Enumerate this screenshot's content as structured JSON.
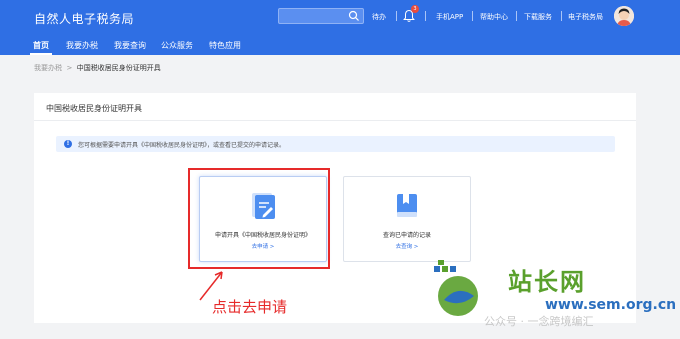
{
  "header": {
    "title": "自然人电子税务局",
    "search": {
      "placeholder": ""
    },
    "links": {
      "pending": "待办",
      "notification_count": "3",
      "mobile_app": "手机APP",
      "help_center": "帮助中心",
      "download": "下载服务",
      "e_tax": "电子税务局"
    }
  },
  "nav": {
    "items": [
      "首页",
      "我要办税",
      "我要查询",
      "公众服务",
      "特色应用"
    ]
  },
  "breadcrumb": {
    "parent": "我要办税",
    "separator": ">",
    "current": "中国税收居民身份证明开具"
  },
  "card": {
    "title": "中国税收居民身份证明开具",
    "notice": "您可根据需要申请开具《中国税收居民身份证明》，或查看已提交的申请记录。",
    "options": [
      {
        "label": "申请开具《中国税收居民身份证明》",
        "link": "去申请 >",
        "icon": "document-edit-icon"
      },
      {
        "label": "查询已申请的记录",
        "link": "去查询 >",
        "icon": "book-icon"
      }
    ]
  },
  "annotation": {
    "callout": "点击去申请"
  },
  "watermark": {
    "brand": "站长网",
    "domain": "www.sem.org.cn",
    "account": "公众号 · 一念跨境编汇"
  },
  "colors": {
    "primary": "#2f6fe4",
    "annotation_red": "#e62a2a"
  }
}
